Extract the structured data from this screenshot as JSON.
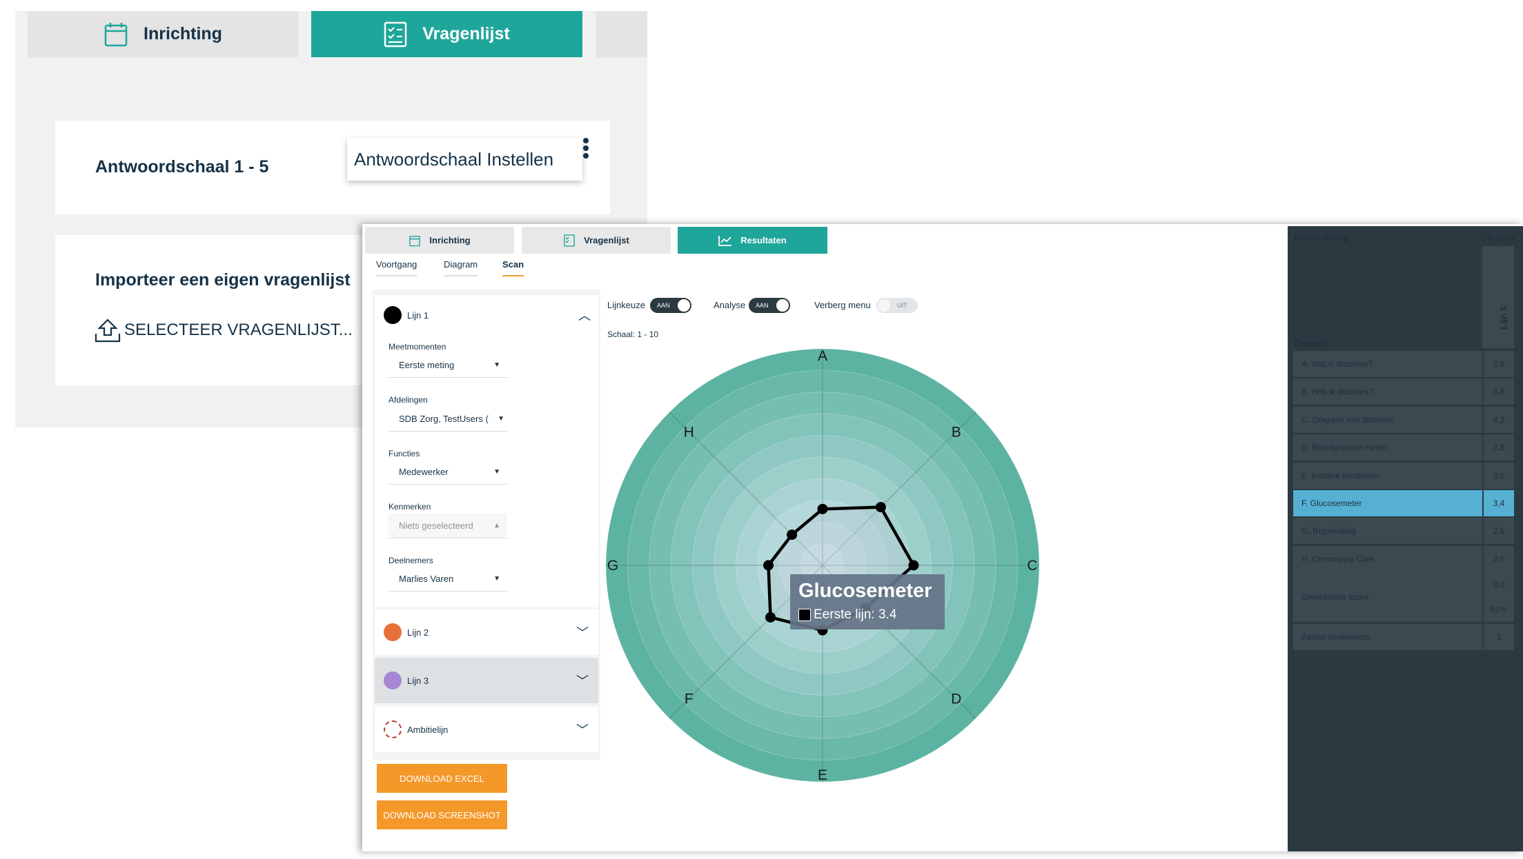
{
  "background": {
    "tabs": {
      "inrichting": "Inrichting",
      "vragenlijst": "Vragenlijst"
    },
    "schaal_label": "Antwoordschaal 1 - 5",
    "schaal_popup": "Antwoordschaal Instellen",
    "import_title": "Importeer een eigen vragenlijst",
    "import_select": "SELECTEER VRAGENLIJST..."
  },
  "window": {
    "tabs": {
      "inrichting": "Inrichting",
      "vragenlijst": "Vragenlijst",
      "resultaten": "Resultaten"
    },
    "subtabs": {
      "voortgang": "Voortgang",
      "diagram": "Diagram",
      "scan": "Scan"
    },
    "active_subtab": "Scan"
  },
  "filters": {
    "line1": {
      "label": "Lijn 1",
      "color": "#000000"
    },
    "meetmomenten": {
      "label": "Meetmomenten",
      "value": "Eerste meting"
    },
    "afdelingen": {
      "label": "Afdelingen",
      "value": "SDB Zorg, TestUsers ("
    },
    "functies": {
      "label": "Functies",
      "value": "Medewerker"
    },
    "kenmerken": {
      "label": "Kenmerken",
      "value": "Niets geselecteerd"
    },
    "deelnemers": {
      "label": "Deelnemers",
      "value": "Marlies Varen"
    },
    "line2": {
      "label": "Lijn 2",
      "color": "#e8703a"
    },
    "line3": {
      "label": "Lijn 3",
      "color": "#a787d4"
    },
    "ambitie": {
      "label": "Ambitielijn",
      "color": "#c0392b"
    },
    "download_excel": "DOWNLOAD EXCEL",
    "download_screenshot": "DOWNLOAD SCREENSHOT"
  },
  "controls": {
    "lijnkeuze": {
      "label": "Lijnkeuze",
      "state": "AAN"
    },
    "analyse": {
      "label": "Analyse",
      "state": "AAN"
    },
    "verberg_menu": {
      "label": "Verberg menu",
      "state": "UIT"
    },
    "schaal": "Schaal: 1 - 10"
  },
  "chart_data": {
    "type": "radar",
    "axes": [
      "A",
      "B",
      "C",
      "D",
      "E",
      "F",
      "G",
      "H"
    ],
    "scale": [
      1,
      10
    ],
    "series": [
      {
        "name": "Eerste lijn",
        "values": [
          2.6,
          3.8,
          4.2,
          2.8,
          3.0,
          3.4,
          2.5,
          2.0
        ],
        "color": "#000000"
      }
    ],
    "tooltip": {
      "title": "Glucosemeter",
      "label": "Eerste lijn: 3.4"
    },
    "colors": {
      "outer": "#5cb3a2",
      "inner": "#cfe3ea"
    }
  },
  "sidebar": {
    "title": "Eerste meting",
    "date": "18-12-24",
    "column": "Lijn 1",
    "themas_label": "Thema's",
    "rows": [
      {
        "name": "A. Wat is diabetes?",
        "value": "2,6"
      },
      {
        "name": "B. Heb ik diabetes?",
        "value": "3,8"
      },
      {
        "name": "C. Omgaan met diabetes",
        "value": "4,2"
      },
      {
        "name": "D. Bloedglucose meten",
        "value": "2,8"
      },
      {
        "name": "E. Insuline toedienen",
        "value": "3,0"
      },
      {
        "name": "F. Glucosemeter",
        "value": "3,4"
      },
      {
        "name": "G. Begeleiding",
        "value": "2,5"
      },
      {
        "name": "H. Community Care",
        "value": "2,0"
      }
    ],
    "average": {
      "label": "Gemiddelde score",
      "value": "3,0",
      "percent": "61%"
    },
    "participants": {
      "label": "Aantal deelnemers",
      "value": "1"
    },
    "selected_color": "#55b0d4"
  }
}
